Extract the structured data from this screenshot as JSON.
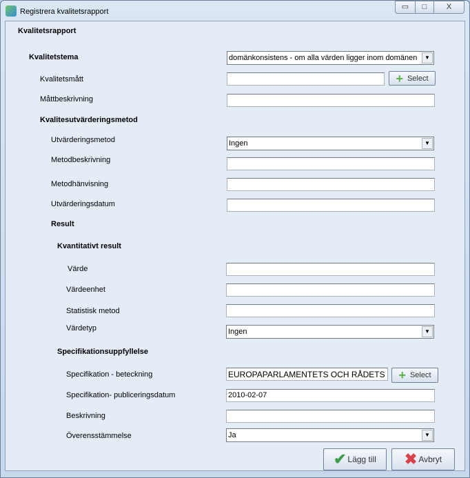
{
  "window": {
    "title": "Registrera kvalitetsrapport",
    "minimize": "▭",
    "maximize": "□",
    "close": "X"
  },
  "form": {
    "heading": "Kvalitetsrapport",
    "tema_label": "Kvalitetstema",
    "tema_value": "domänkonsistens - om alla värden ligger inom domänen",
    "matt_label": "Kvalitetsmått",
    "matt_value": "",
    "select_label": "Select",
    "mattbeskr_label": "Måttbeskrivning",
    "mattbeskr_value": "",
    "metod_heading": "Kvalitesutvärderingsmetod",
    "utvmetod_label": "Utvärderingsmetod",
    "utvmetod_value": "Ingen",
    "metodbeskr_label": "Metodbeskrivning",
    "metodbeskr_value": "",
    "metodhanv_label": "Metodhänvisning",
    "metodhanv_value": "",
    "utvdatum_label": "Utvärderingsdatum",
    "utvdatum_value": "",
    "result_heading": "Result",
    "kvant_heading": "Kvantitativt result",
    "varde_label": "Värde",
    "varde_value": "",
    "vardeenhet_label": "Värdeenhet",
    "vardeenhet_value": "",
    "statmetod_label": "Statistisk metod",
    "statmetod_value": "",
    "vardetyp_label": "Värdetyp",
    "vardetyp_value": "Ingen",
    "spec_heading": "Specifikationsuppfyllelse",
    "specbet_label": "Specifikation - beteckning",
    "specbet_value": "EUROPAPARLAMENTETS OCH RÅDETS DIREKTIV",
    "specpub_label": "Specifikation- publiceringsdatum",
    "specpub_value": "2010-02-07",
    "beskr_label": "Beskrivning",
    "beskr_value": "",
    "overens_label": "Överensstämmelse",
    "overens_value": "Ja",
    "add_label": "Lägg till",
    "cancel_label": "Avbryt"
  },
  "icons": {
    "select": "plus-icon",
    "add": "check-icon",
    "cancel": "x-icon"
  },
  "colors": {
    "plus": "#5cb04a",
    "check": "#3f9a4a",
    "cancel": "#d9434b"
  }
}
